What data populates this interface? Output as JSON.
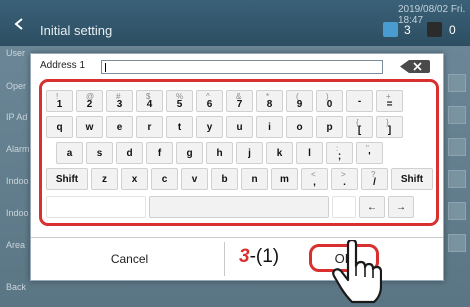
{
  "header": {
    "back_glyph": "<",
    "title": "Initial setting",
    "datetime": "2019/08/02 Fri. 18:47",
    "count_power": "3",
    "count_warning": "0"
  },
  "background_labels": [
    "User",
    "Oper",
    "IP Ad",
    "Alarm",
    "Indoo",
    "Indoo",
    "Area",
    "Back"
  ],
  "dialog": {
    "field_label": "Address 1",
    "field_value": "",
    "cancel_label": "Cancel",
    "ok_label": "OK",
    "step_number": "3",
    "step_sub": "-(1)"
  },
  "keyboard": {
    "row1": [
      [
        "!",
        "1"
      ],
      [
        "@",
        "2"
      ],
      [
        "#",
        "3"
      ],
      [
        "$",
        "4"
      ],
      [
        "%",
        "5"
      ],
      [
        "^",
        "6"
      ],
      [
        "&",
        "7"
      ],
      [
        "*",
        "8"
      ],
      [
        "(",
        "9"
      ],
      [
        ")",
        "0"
      ],
      [
        "",
        "-"
      ],
      [
        "+",
        "="
      ]
    ],
    "row2": [
      [
        "",
        "q"
      ],
      [
        "",
        "w"
      ],
      [
        "",
        "e"
      ],
      [
        "",
        "r"
      ],
      [
        "",
        "t"
      ],
      [
        "",
        "y"
      ],
      [
        "",
        "u"
      ],
      [
        "",
        "i"
      ],
      [
        "",
        "o"
      ],
      [
        "",
        "p"
      ],
      [
        "{",
        "["
      ],
      [
        "}",
        "]"
      ]
    ],
    "row3": [
      [
        "",
        "a"
      ],
      [
        "",
        "s"
      ],
      [
        "",
        "d"
      ],
      [
        "",
        "f"
      ],
      [
        "",
        "g"
      ],
      [
        "",
        "h"
      ],
      [
        "",
        "j"
      ],
      [
        "",
        "k"
      ],
      [
        "",
        "l"
      ],
      [
        ":",
        ";"
      ],
      [
        "\"",
        "'"
      ]
    ],
    "row4": [
      [
        "",
        "Shift"
      ],
      [
        "",
        "z"
      ],
      [
        "",
        "x"
      ],
      [
        "",
        "c"
      ],
      [
        "",
        "v"
      ],
      [
        "",
        "b"
      ],
      [
        "",
        "n"
      ],
      [
        "",
        "m"
      ],
      [
        "<",
        ","
      ],
      [
        ">",
        "."
      ],
      [
        "?",
        "/"
      ],
      [
        "",
        "Shift"
      ]
    ],
    "left_arrow": "←",
    "right_arrow": "→"
  },
  "colors": {
    "accent_red": "#d8302f",
    "header_bg": "#2d4e62"
  }
}
